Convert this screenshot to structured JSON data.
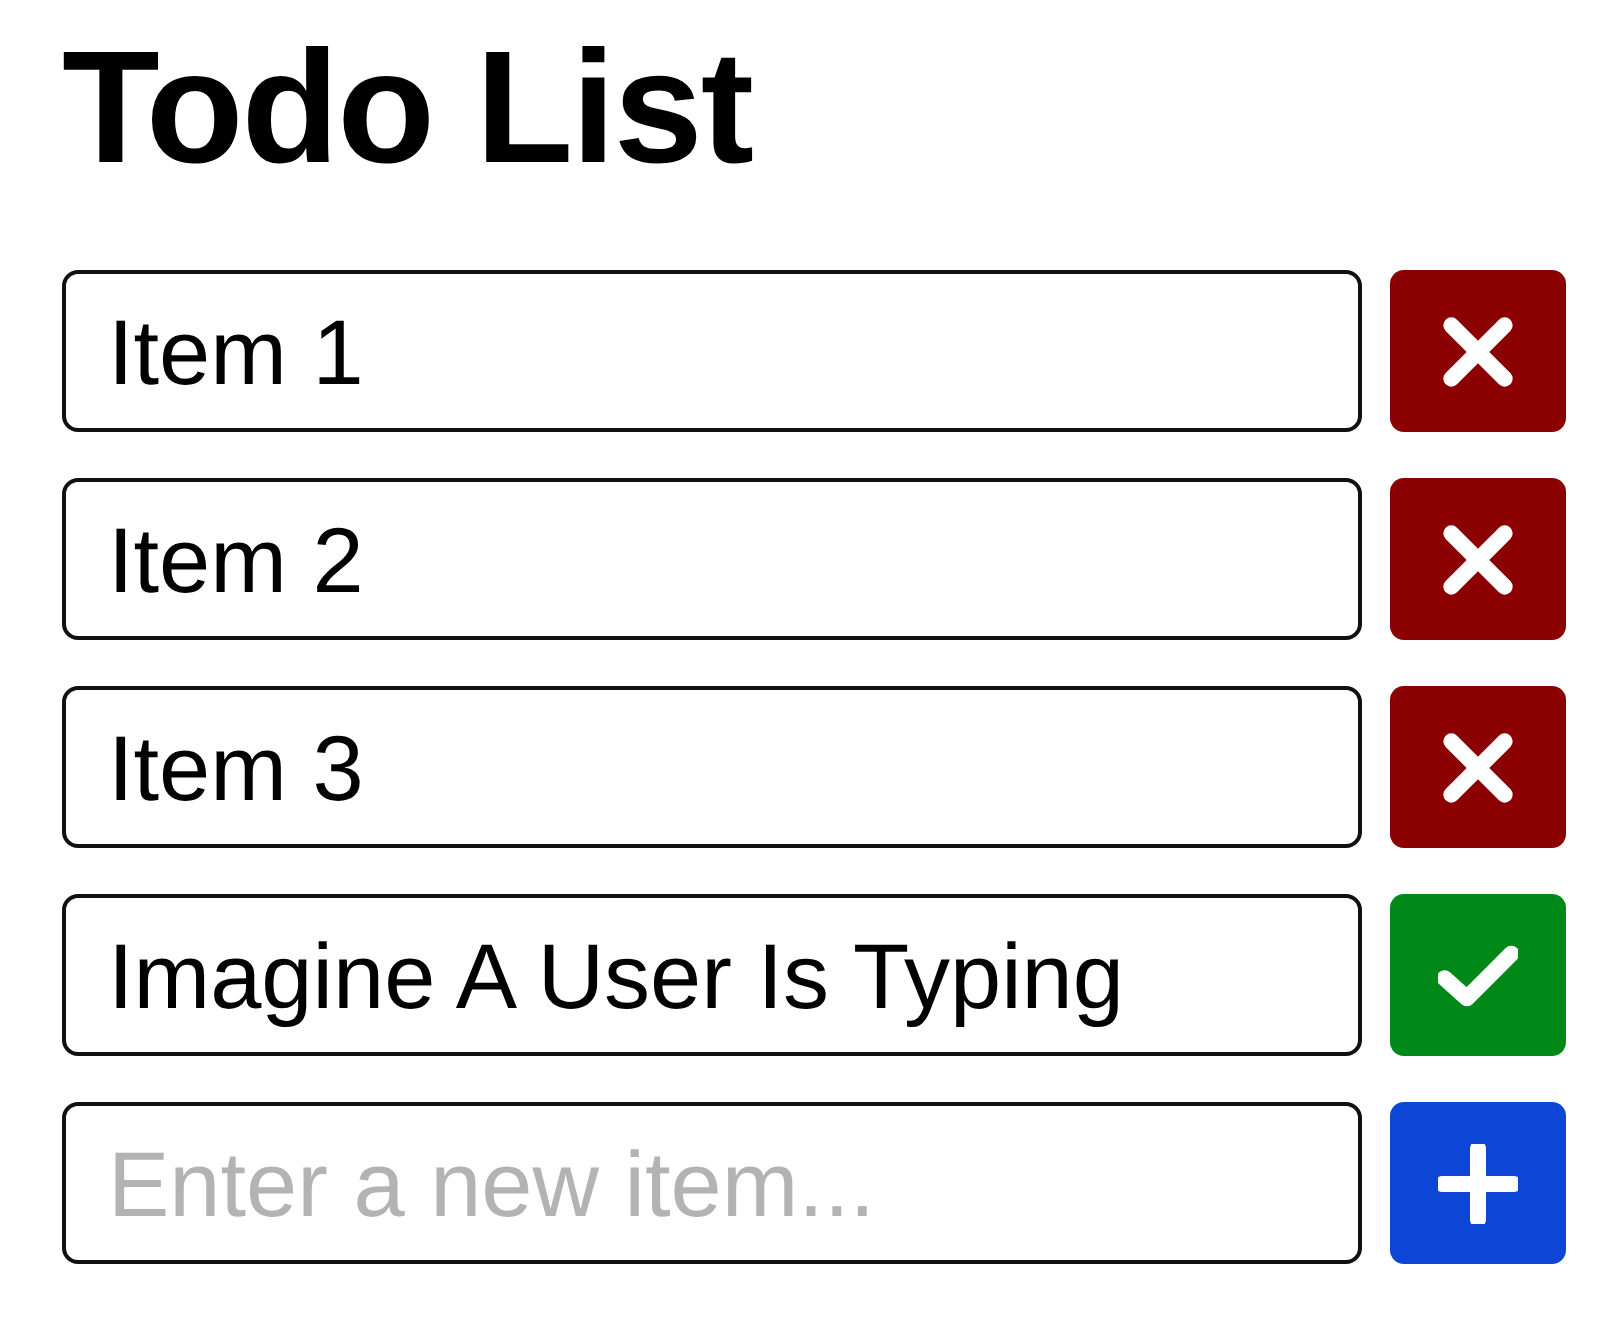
{
  "title": "Todo List",
  "rows": [
    {
      "kind": "saved",
      "value": "Item 1"
    },
    {
      "kind": "saved",
      "value": "Item 2"
    },
    {
      "kind": "saved",
      "value": "Item 3"
    },
    {
      "kind": "editing",
      "value": "Imagine A User Is Typing"
    },
    {
      "kind": "new",
      "placeholder": "Enter a new item..."
    }
  ]
}
